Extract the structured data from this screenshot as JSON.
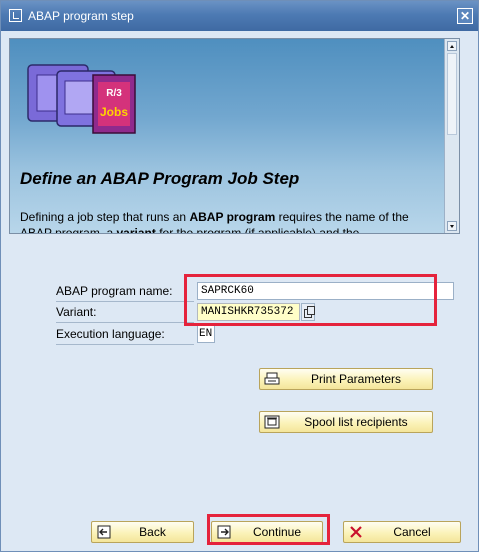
{
  "window": {
    "title": "ABAP program step",
    "close_symbol": "✕"
  },
  "info": {
    "logo_text_r3": "R/3",
    "logo_text_jobs": "Jobs",
    "heading": "Define an ABAP Program Job Step",
    "body_part1": "Defining a job step that runs an ",
    "body_bold1": "ABAP program",
    "body_part2": " requires the name of the ABAP program, a ",
    "body_bold2": "variant",
    "body_part3": " for the program (if applicable) and the"
  },
  "form": {
    "program_label": "ABAP program name:",
    "program_value": "SAPRCK60",
    "variant_label": "Variant:",
    "variant_value": "MANISHKR735372",
    "language_label": "Execution language:",
    "language_value": "EN"
  },
  "buttons": {
    "print_parameters": "Print Parameters",
    "spool_recipients": "Spool list recipients",
    "back": "Back",
    "continue": "Continue",
    "cancel": "Cancel"
  },
  "colors": {
    "highlight": "#e5233c",
    "button_face": "#fbf3b9",
    "titlebar": "#4d7ab3"
  }
}
